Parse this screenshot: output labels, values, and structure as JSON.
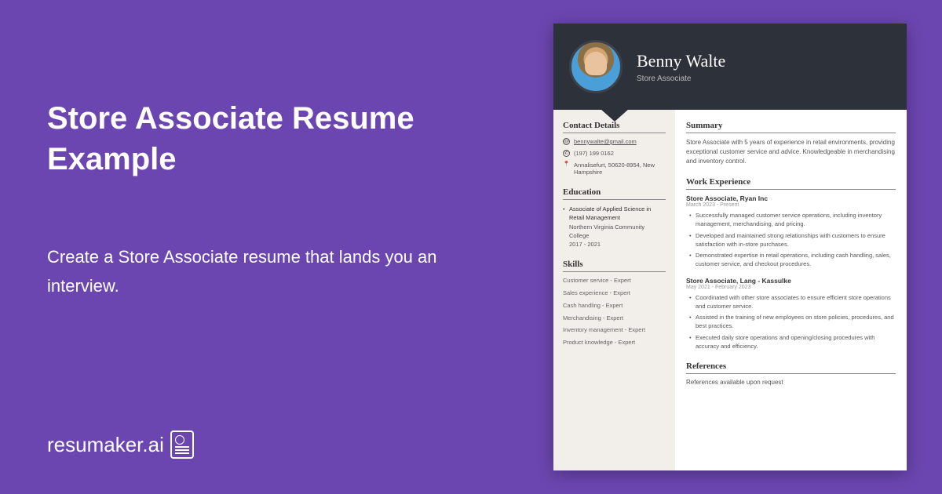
{
  "hero": {
    "title": "Store Associate Resume Example",
    "subtitle": "Create a Store Associate resume that lands you an interview."
  },
  "brand": {
    "name": "resumaker.ai"
  },
  "resume": {
    "name": "Benny Walte",
    "role": "Store Associate",
    "contact": {
      "heading": "Contact Details",
      "email": "bennywalte@gmail.com",
      "phone": "(197) 199 0162",
      "address": "Annalisefurt, 50620-8954, New Hampshire"
    },
    "education": {
      "heading": "Education",
      "degree": "Associate of Applied Science in Retail Management",
      "school": "Northern Virginia Community College",
      "dates": "2017 - 2021"
    },
    "skills": {
      "heading": "Skills",
      "items": [
        "Customer service - Expert",
        "Sales experience - Expert",
        "Cash handling - Expert",
        "Merchandising - Expert",
        "Inventory management - Expert",
        "Product knowledge - Expert"
      ]
    },
    "summary": {
      "heading": "Summary",
      "text": "Store Associate with 5 years of experience in retail environments, providing exceptional customer service and advice. Knowledgeable in merchandising and inventory control."
    },
    "experience": {
      "heading": "Work Experience",
      "jobs": [
        {
          "title": "Store Associate, Ryan Inc",
          "dates": "March 2023 - Present",
          "bullets": [
            "Successfully managed customer service operations, including inventory management, merchandising, and pricing.",
            "Developed and maintained strong relationships with customers to ensure satisfaction with in-store purchases.",
            "Demonstrated expertise in retail operations, including cash handling, sales, customer service, and checkout procedures."
          ]
        },
        {
          "title": "Store Associate, Lang - Kassulke",
          "dates": "May 2021 - February 2023",
          "bullets": [
            "Coordinated with other store associates to ensure efficient store operations and customer service.",
            "Assisted in the training of new employees on store policies, procedures, and best practices.",
            "Executed daily store operations and opening/closing procedures with accuracy and efficiency."
          ]
        }
      ]
    },
    "references": {
      "heading": "References",
      "text": "References available upon request"
    }
  }
}
